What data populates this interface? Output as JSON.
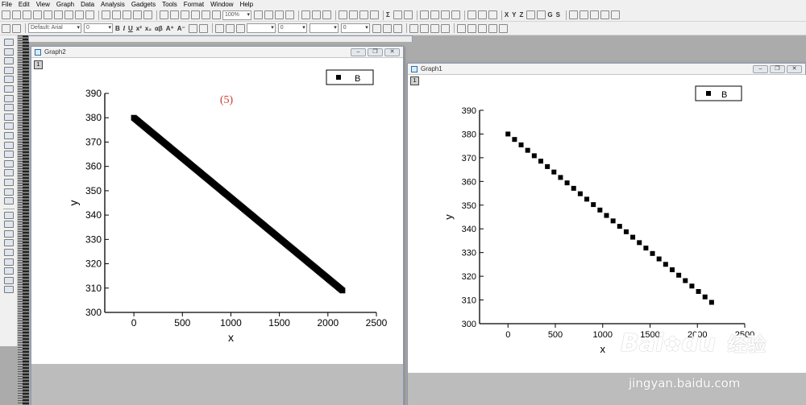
{
  "menubar": {
    "items": [
      "File",
      "Edit",
      "View",
      "Graph",
      "Data",
      "Analysis",
      "Gadgets",
      "Tools",
      "Format",
      "Window",
      "Help"
    ]
  },
  "toolbar": {
    "zoom": "100%",
    "font_name": "Default: Arial",
    "font_size": "0",
    "line_width": "0",
    "border_width": "0",
    "glyphs": {
      "bold": "B",
      "italic": "I",
      "underline": "U",
      "superscript": "x²",
      "subscript": "x₂",
      "greek": "αβ",
      "grow_font": "A⁺",
      "shrink_font": "A⁻",
      "sum": "Σ",
      "x": "X",
      "y": "Y",
      "z": "Z",
      "set_g": "G",
      "set_s": "S",
      "text_tool": "T"
    }
  },
  "graph2": {
    "title": "Graph2",
    "layer": "1",
    "annotation": "(5)",
    "legend": "B"
  },
  "graph1": {
    "title": "Graph1",
    "layer": "1",
    "legend": "B"
  },
  "watermark": {
    "brand": "Bai",
    "brand2": "du",
    "site": "经验",
    "url": "jingyan.baidu.com"
  },
  "colors": {
    "annotation": "#d03a2c",
    "marker": "#000000"
  },
  "chart_data": [
    {
      "type": "scatter",
      "name": "graph2",
      "xlabel": "x",
      "ylabel": "y",
      "xlim": [
        -300,
        2500
      ],
      "ylim": [
        300,
        390
      ],
      "xticks": [
        0,
        500,
        1000,
        1500,
        2000,
        2500
      ],
      "yticks": [
        300,
        310,
        320,
        330,
        340,
        350,
        360,
        370,
        380,
        390
      ],
      "legend": "top-right",
      "series": [
        {
          "name": "B",
          "marker": "square",
          "dense": true,
          "x_start": 0,
          "x_end": 2150,
          "y_start": 380,
          "y_end": 309
        }
      ]
    },
    {
      "type": "scatter",
      "name": "graph1",
      "xlabel": "x",
      "ylabel": "y",
      "xlim": [
        -300,
        2500
      ],
      "ylim": [
        300,
        390
      ],
      "xticks": [
        0,
        500,
        1000,
        1500,
        2000,
        2500
      ],
      "yticks": [
        300,
        310,
        320,
        330,
        340,
        350,
        360,
        370,
        380,
        390
      ],
      "legend": "top-right",
      "series": [
        {
          "name": "B",
          "marker": "square",
          "x": [
            0,
            69.35,
            138.71,
            208.06,
            277.42,
            346.77,
            416.13,
            485.48,
            554.84,
            624.19,
            693.55,
            762.9,
            832.26,
            901.61,
            970.97,
            1040.32,
            1109.68,
            1179.03,
            1248.39,
            1317.74,
            1387.1,
            1456.45,
            1525.81,
            1595.16,
            1664.52,
            1733.87,
            1803.23,
            1872.58,
            1941.94,
            2011.29,
            2080.65,
            2150
          ],
          "y": [
            380,
            377.71,
            375.42,
            373.13,
            370.84,
            368.55,
            366.26,
            363.97,
            361.68,
            359.39,
            357.1,
            354.81,
            352.52,
            350.23,
            347.94,
            345.65,
            343.35,
            341.06,
            338.77,
            336.48,
            334.19,
            331.9,
            329.61,
            327.32,
            325.03,
            322.74,
            320.45,
            318.16,
            315.87,
            313.58,
            311.29,
            309
          ]
        }
      ]
    }
  ]
}
